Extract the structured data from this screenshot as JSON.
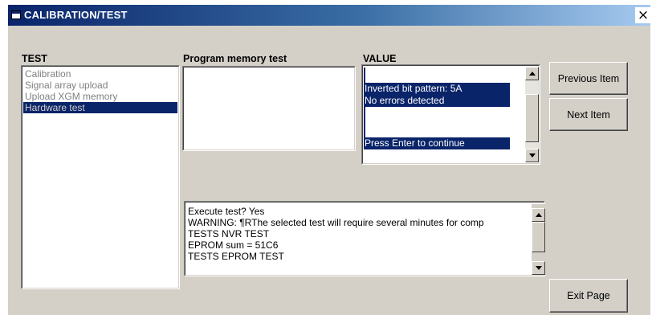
{
  "window": {
    "title": "CALIBRATION/TEST",
    "close_glyph": "×",
    "title_icon": "window-app-icon"
  },
  "labels": {
    "test": "TEST",
    "program": "Program memory test",
    "value": "VALUE"
  },
  "test_list": {
    "items": [
      {
        "label": "Calibration",
        "selected": false
      },
      {
        "label": "Signal array upload",
        "selected": false
      },
      {
        "label": "Upload XGM memory",
        "selected": false
      },
      {
        "label": "Hardware test",
        "selected": true
      }
    ]
  },
  "value_box": {
    "lines": [
      "Inverted bit pattern: 5A",
      " No errors detected",
      "Press Enter to continue"
    ]
  },
  "log_box": {
    "lines": [
      "Execute test?  Yes",
      "WARNING:  ¶RThe selected test will require several minutes for comp",
      "TESTS   NVR TEST",
      "EPROM sum =  51C6",
      "TESTS   EPROM TEST"
    ]
  },
  "buttons": {
    "previous": "Previous Item",
    "next": "Next Item",
    "exit": "Exit Page"
  },
  "icons": {
    "scroll_up": "scroll-up-arrow-icon",
    "scroll_down": "scroll-down-arrow-icon"
  },
  "colors": {
    "window_face": "#d4d0c8",
    "title_bar_start": "#0a246a",
    "title_bar_end": "#a6caf0",
    "selection": "#0a246a"
  }
}
